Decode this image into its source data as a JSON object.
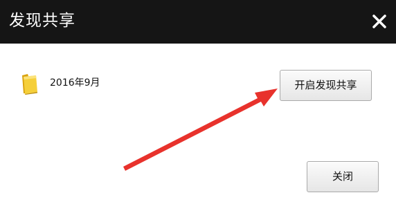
{
  "dialog": {
    "title": "发现共享",
    "close_icon": "close-icon"
  },
  "content": {
    "folder_icon": "folder-icon",
    "folder_name": "2016年9月",
    "share_button_label": "开启发现共享"
  },
  "footer": {
    "close_button_label": "关闭"
  },
  "annotation": {
    "arrow_color": "#e8322c"
  },
  "colors": {
    "titlebar": "#151515",
    "title_text": "#ffffff",
    "folder": "#f0c419"
  }
}
